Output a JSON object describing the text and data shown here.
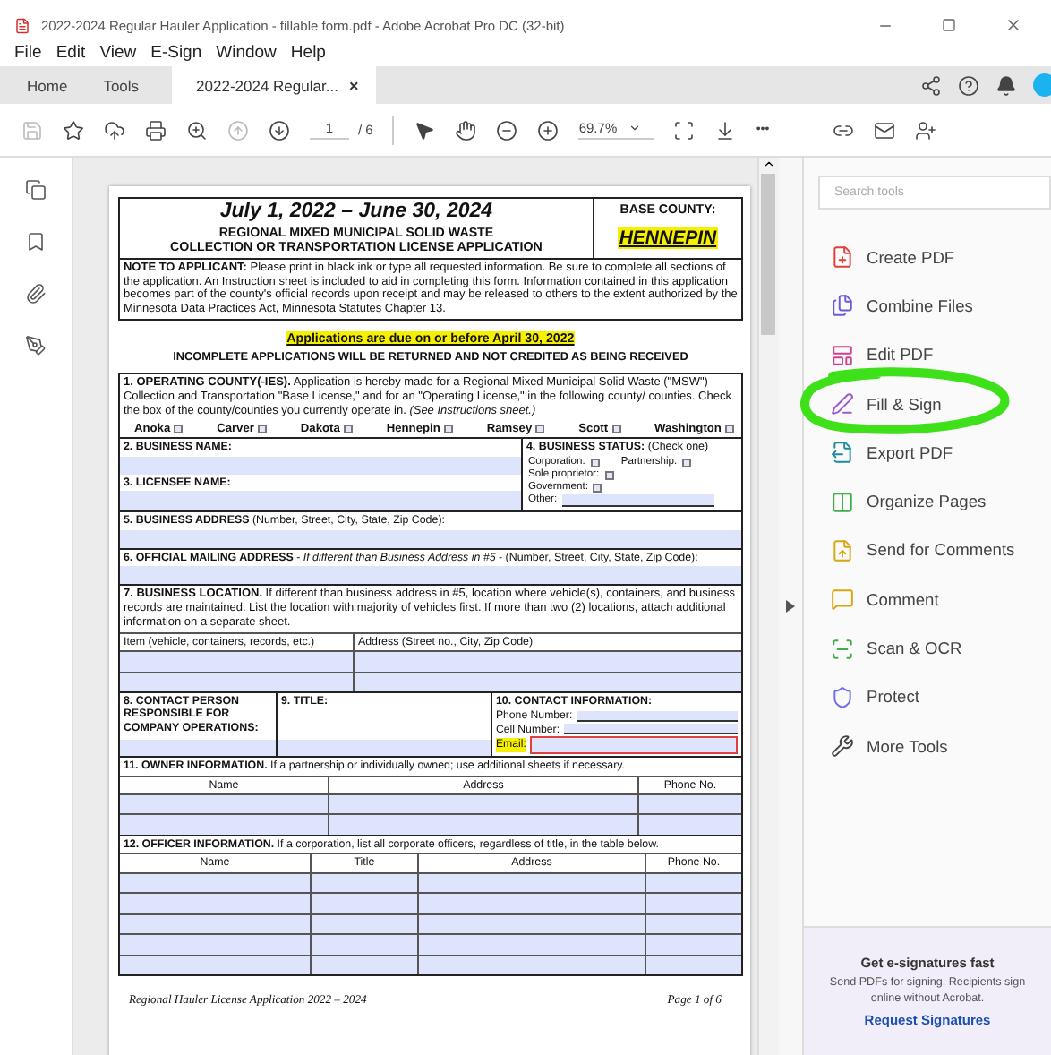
{
  "window": {
    "title": "2022-2024 Regular Hauler Application - fillable form.pdf - Adobe Acrobat Pro DC (32-bit)"
  },
  "menu": [
    "File",
    "Edit",
    "View",
    "E-Sign",
    "Window",
    "Help"
  ],
  "tabs": [
    {
      "label": "Home",
      "selected": false
    },
    {
      "label": "Tools",
      "selected": false
    },
    {
      "label": "2022-2024 Regular...",
      "selected": true,
      "close": "×"
    }
  ],
  "toolbar": {
    "page": "1",
    "page_count": "/ 6",
    "zoom": "69.7%",
    "more": "•••"
  },
  "form": {
    "period": "July 1, 2022 – June 30, 2024",
    "title_lines": [
      "REGIONAL MIXED MUNICIPAL SOLID WASTE",
      "COLLECTION OR TRANSPORTATION LICENSE APPLICATION"
    ],
    "base_county_label": "BASE COUNTY:",
    "base_county": "HENNEPIN",
    "note": "**NOTE TO APPLICANT:** Please print in black ink or type all requested information. Be sure to complete all sections of the application. An Instruction sheet is included to aid in completing this form. Information contained in this application becomes part of the county's official records upon receipt and may be released to others to the extent authorized by the Minnesota Data Practices Act, Minnesota Statutes Chapter 13.",
    "due": "Applications are due on or before April 30, 2022",
    "incomplete": "INCOMPLETE APPLICATIONS WILL BE RETURNED AND NOT CREDITED AS BEING RECEIVED",
    "operating": "**1. OPERATING COUNTY(-IES).** Application is hereby made for a Regional Mixed Municipal Solid Waste (\"MSW\") Collection and Transportation \"Base License,\" and for an \"Operating License,\" in the following county/ counties. Check the box of the county/counties you currently operate in. *(See Instructions sheet.)*",
    "counties": [
      {
        "name": "Anoka",
        "checked": false
      },
      {
        "name": "Carver",
        "checked": false
      },
      {
        "name": "Dakota",
        "checked": false
      },
      {
        "name": "Hennepin",
        "checked": false
      },
      {
        "name": "Ramsey",
        "checked": false
      },
      {
        "name": "Scott",
        "checked": false
      },
      {
        "name": "Washington",
        "checked": false
      }
    ],
    "business_name": "2. BUSINESS NAME:",
    "licensee_name": "3. LICENSEE NAME:",
    "status": {
      "label": "**4. BUSINESS STATUS:** (Check one)",
      "options": [
        {
          "label": "Corporation:",
          "checked": false
        },
        {
          "label": "Partnership:",
          "checked": false
        },
        {
          "label": "Sole proprietor:",
          "checked": false
        },
        {
          "label": "Government:",
          "checked": false
        }
      ],
      "other": "Other:"
    },
    "business_address": "**5. BUSINESS ADDRESS** (Number, Street, City, State, Zip Code):",
    "mailing_address": "**6. OFFICIAL MAILING ADDRESS** - *If different than Business Address in #5* - (Number, Street, City, State, Zip Code):",
    "location": "**7. BUSINESS LOCATION.** If different than business address in #5, location where vehicle(s), containers, and business records are maintained. List the location with majority of vehicles first. If more than two (2) locations, attach additional information on a separate sheet.",
    "location_columns": [
      "Item (vehicle, containers, records, etc.)",
      "Address (Street no., City, Zip Code)"
    ],
    "contact_person": "8. CONTACT PERSON RESPONSIBLE FOR COMPANY OPERATIONS:",
    "title_label": "9. TITLE:",
    "contact_info": {
      "label": "10. CONTACT INFORMATION:",
      "phone": "Phone Number:",
      "cell": "Cell Number:",
      "email": "Email:"
    },
    "owner": {
      "heading": "**11. OWNER INFORMATION.** If a partnership or individually owned; use additional sheets if necessary.",
      "columns": [
        "Name",
        "Address",
        "Phone No."
      ]
    },
    "officer": {
      "heading": "**12. OFFICER INFORMATION.** If a corporation, list all corporate officers, regardless of title, in the table below.",
      "columns": [
        "Name",
        "Title",
        "Address",
        "Phone No."
      ]
    },
    "footer_left": "Regional Hauler License Application 2022 – 2024",
    "footer_right": "Page 1 of 6"
  },
  "tools_panel": {
    "search": {
      "placeholder": "Search tools"
    },
    "tools": [
      {
        "label": "Create PDF",
        "circled": false
      },
      {
        "label": "Combine Files",
        "circled": false
      },
      {
        "label": "Edit PDF",
        "circled": false
      },
      {
        "label": "Fill & Sign",
        "circled": true
      },
      {
        "label": "Export PDF",
        "circled": false
      },
      {
        "label": "Organize Pages",
        "circled": false
      },
      {
        "label": "Send for Comments",
        "circled": false
      },
      {
        "label": "Comment",
        "circled": false
      },
      {
        "label": "Scan & OCR",
        "circled": false
      },
      {
        "label": "Protect",
        "circled": false
      },
      {
        "label": "More Tools",
        "circled": false
      }
    ],
    "promo": {
      "title": "Get e-signatures fast",
      "text": "Send PDFs for signing. Recipients sign online without Acrobat.",
      "link": "Request Signatures"
    }
  }
}
